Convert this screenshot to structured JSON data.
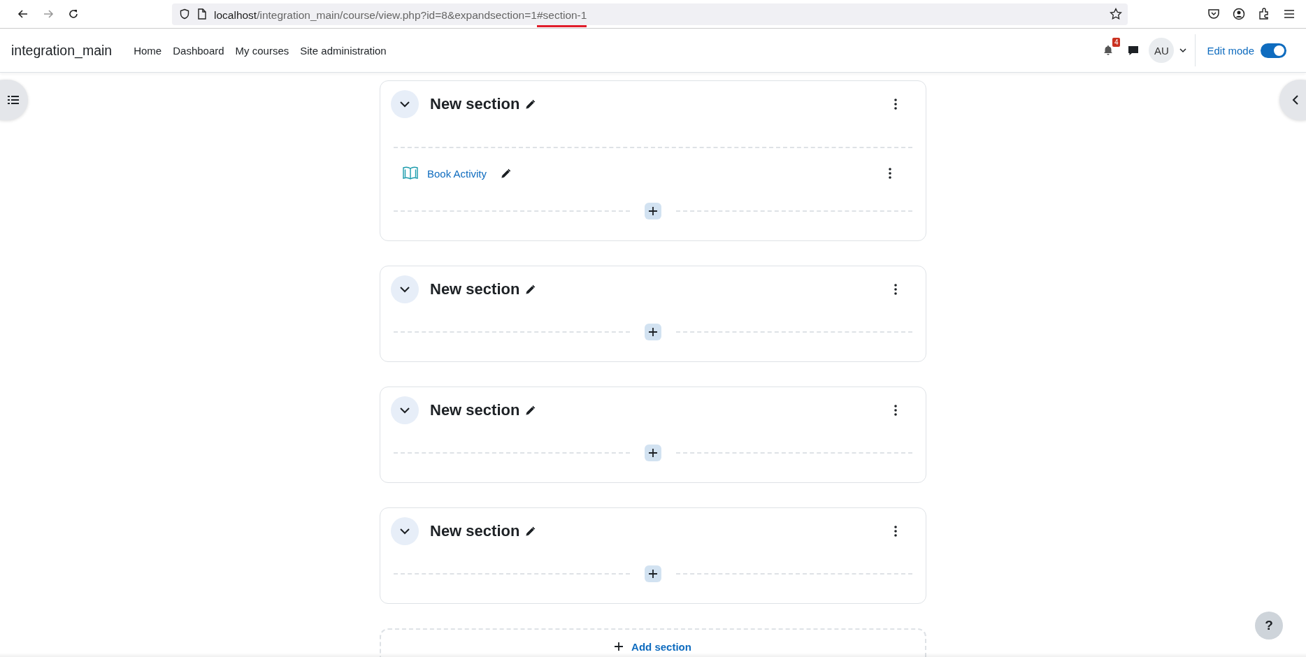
{
  "browser": {
    "url_host": "localhost",
    "url_path": "/integration_main/course/view.php?id=8&expandsection=1",
    "url_fragment": "#section-1"
  },
  "navbar": {
    "site_name": "integration_main",
    "links": [
      "Home",
      "Dashboard",
      "My courses",
      "Site administration"
    ],
    "notification_count": "4",
    "avatar_initials": "AU",
    "edit_mode": {
      "label": "Edit mode",
      "on": true
    }
  },
  "sections": [
    {
      "title": "New section",
      "expanded": true,
      "activities": [
        {
          "name": "Book Activity"
        }
      ]
    },
    {
      "title": "New section",
      "expanded": true
    },
    {
      "title": "New section",
      "expanded": true
    },
    {
      "title": "New section",
      "expanded": true
    }
  ],
  "add_section": {
    "label": "Add section"
  },
  "help": {
    "label": "?"
  }
}
